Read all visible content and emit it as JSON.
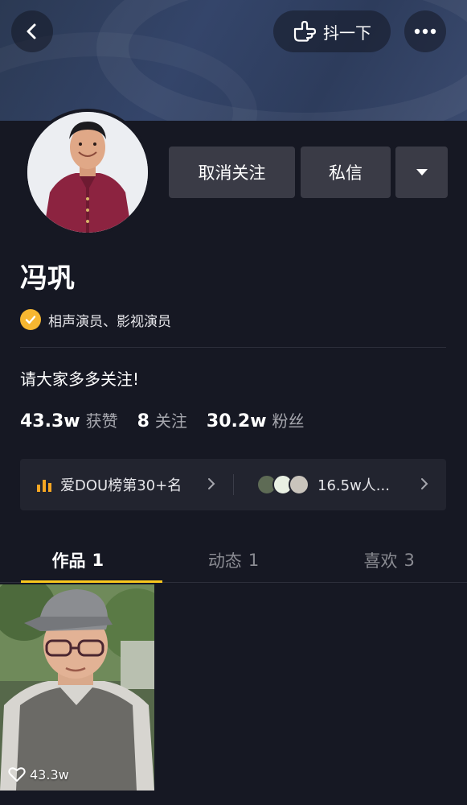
{
  "header": {
    "shake_label": "抖一下",
    "back_icon": "chevron-left-icon",
    "shake_icon": "hand-point-icon",
    "more_icon": "ellipsis-icon"
  },
  "profile": {
    "name": "冯巩",
    "verification": "相声演员、影视演员",
    "bio": "请大家多多关注!",
    "accent_color": "#fac81e",
    "verify_color": "#f7b731"
  },
  "actions": {
    "unfollow_label": "取消关注",
    "message_label": "私信",
    "dropdown_icon": "caret-down-icon"
  },
  "stats": [
    {
      "value": "43.3w",
      "label": "获赞"
    },
    {
      "value": "8",
      "label": "关注"
    },
    {
      "value": "30.2w",
      "label": "粉丝"
    }
  ],
  "rank_bar": {
    "rank_label": "爱DOU榜第30+名",
    "viewers_label": "16.5w人..."
  },
  "tabs": [
    {
      "label": "作品",
      "count": "1",
      "active": true
    },
    {
      "label": "动态",
      "count": "1",
      "active": false
    },
    {
      "label": "喜欢",
      "count": "3",
      "active": false
    }
  ],
  "videos": [
    {
      "likes": "43.3w"
    }
  ]
}
